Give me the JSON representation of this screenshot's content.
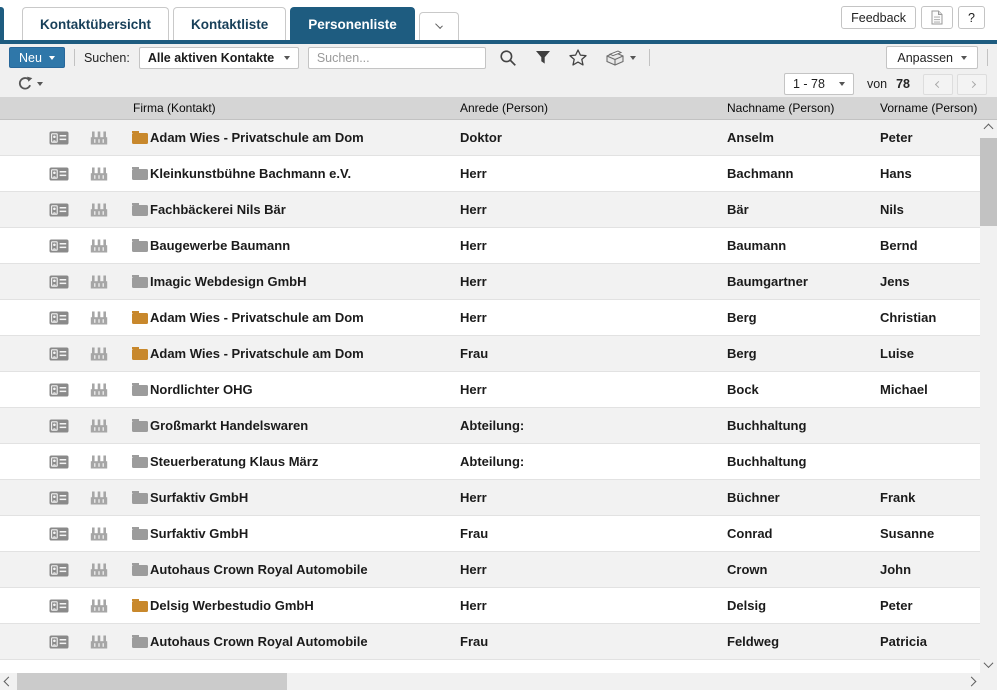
{
  "colors": {
    "accent": "#1e5c80",
    "new_button_blue": "#2f77a9",
    "folder_orange": "#c8882c",
    "folder_gray": "#9c9c9c",
    "header_bg": "#d5d5d5",
    "row_alt_bg": "#f2f2f2",
    "toolbar_bg": "#f0f0f0"
  },
  "icons": {
    "tab_overflow": "chevron-down",
    "document_button": "document-page",
    "search": "magnifier",
    "filter": "funnel-filled",
    "favorite": "star-outline",
    "card_box": "card-file-box",
    "refresh": "circular-arrow",
    "contact_card": "id-badge",
    "company": "factory",
    "folder": "folder"
  },
  "tab_bar": {
    "tabs": [
      {
        "label": "Kontaktübersicht"
      },
      {
        "label": "Kontaktliste"
      },
      {
        "label": "Personenliste"
      }
    ],
    "active_tab": "Personenliste",
    "feedback_button": "Feedback",
    "help_button": "?"
  },
  "toolbar": {
    "new_button": "Neu",
    "search_label": "Suchen:",
    "saved_search_value": "Alle aktiven Kontakte",
    "search_placeholder": "Suchen...",
    "customize_button": "Anpassen"
  },
  "pagination": {
    "range_value": "1 - 78",
    "of_label": "von",
    "total": "78"
  },
  "table": {
    "columns": [
      "Firma (Kontakt)",
      "Anrede (Person)",
      "Nachname (Person)",
      "Vorname (Person)"
    ],
    "rows": [
      {
        "firma": "Adam Wies - Privatschule am Dom",
        "folder": "orange",
        "anrede": "Doktor",
        "nachname": "Anselm",
        "vorname": "Peter"
      },
      {
        "firma": "Kleinkunstbühne Bachmann e.V.",
        "folder": "gray",
        "anrede": "Herr",
        "nachname": "Bachmann",
        "vorname": "Hans"
      },
      {
        "firma": "Fachbäckerei Nils Bär",
        "folder": "gray",
        "anrede": "Herr",
        "nachname": "Bär",
        "vorname": "Nils"
      },
      {
        "firma": "Baugewerbe Baumann",
        "folder": "gray",
        "anrede": "Herr",
        "nachname": "Baumann",
        "vorname": "Bernd"
      },
      {
        "firma": "Imagic Webdesign GmbH",
        "folder": "gray",
        "anrede": "Herr",
        "nachname": "Baumgartner",
        "vorname": "Jens"
      },
      {
        "firma": "Adam Wies - Privatschule am Dom",
        "folder": "orange",
        "anrede": "Herr",
        "nachname": "Berg",
        "vorname": "Christian"
      },
      {
        "firma": "Adam Wies - Privatschule am Dom",
        "folder": "orange",
        "anrede": "Frau",
        "nachname": "Berg",
        "vorname": "Luise"
      },
      {
        "firma": "Nordlichter OHG",
        "folder": "gray",
        "anrede": "Herr",
        "nachname": "Bock",
        "vorname": "Michael"
      },
      {
        "firma": "Großmarkt Handelswaren",
        "folder": "gray",
        "anrede": "Abteilung:",
        "nachname": "Buchhaltung",
        "vorname": ""
      },
      {
        "firma": "Steuerberatung Klaus März",
        "folder": "gray",
        "anrede": "Abteilung:",
        "nachname": "Buchhaltung",
        "vorname": ""
      },
      {
        "firma": "Surfaktiv GmbH",
        "folder": "gray",
        "anrede": "Herr",
        "nachname": "Büchner",
        "vorname": "Frank"
      },
      {
        "firma": "Surfaktiv GmbH",
        "folder": "gray",
        "anrede": "Frau",
        "nachname": "Conrad",
        "vorname": "Susanne"
      },
      {
        "firma": "Autohaus Crown Royal Automobile",
        "folder": "gray",
        "anrede": "Herr",
        "nachname": "Crown",
        "vorname": "John"
      },
      {
        "firma": "Delsig Werbestudio GmbH",
        "folder": "orange",
        "anrede": "Herr",
        "nachname": "Delsig",
        "vorname": "Peter"
      },
      {
        "firma": "Autohaus Crown Royal Automobile",
        "folder": "gray",
        "anrede": "Frau",
        "nachname": "Feldweg",
        "vorname": "Patricia"
      }
    ]
  }
}
